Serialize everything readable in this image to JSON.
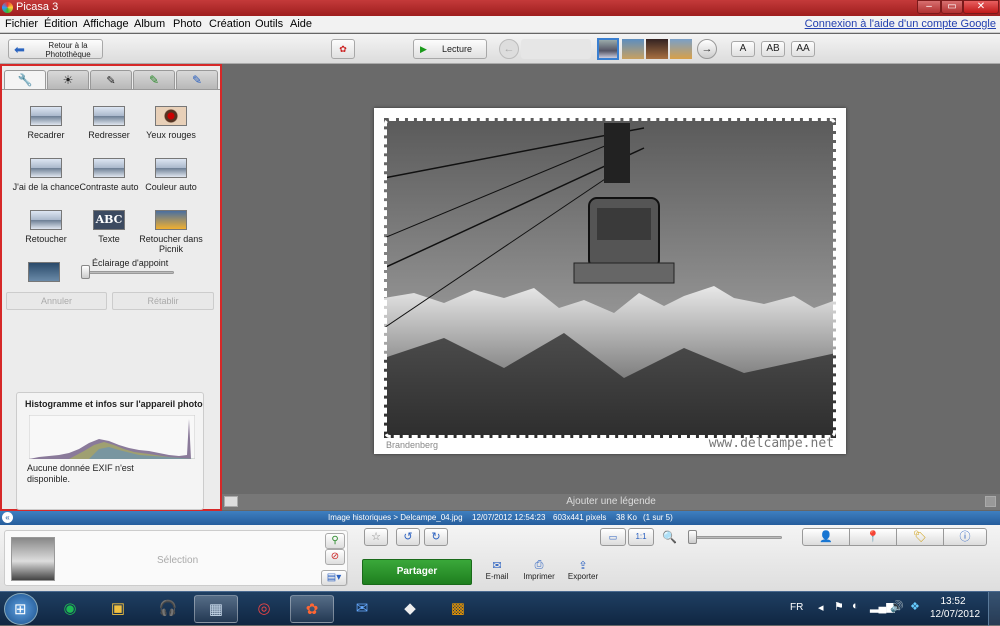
{
  "window": {
    "title": "Picasa 3",
    "controls": {
      "minimize": "–",
      "maximize": "▭",
      "close": "✕"
    }
  },
  "menu": {
    "items": [
      "Fichier",
      "Édition",
      "Affichage",
      "Album",
      "Photo",
      "Création",
      "Outils",
      "Aide"
    ],
    "account_link": "Connexion à l'aide d'un compte Google"
  },
  "toolbar": {
    "back_label": "Retour à la Photothèque",
    "play_label": "Lecture",
    "text_size_buttons": [
      "A",
      "AB",
      "AA"
    ]
  },
  "edit_panel": {
    "tabs": [
      "wrench-icon",
      "sun-icon",
      "brush-icon",
      "brush-green-icon",
      "brush-blue-icon"
    ],
    "tools": [
      {
        "label": "Recadrer"
      },
      {
        "label": "Redresser"
      },
      {
        "label": "Yeux rouges"
      },
      {
        "label": "J'ai de la chance"
      },
      {
        "label": "Contraste auto"
      },
      {
        "label": "Couleur auto"
      },
      {
        "label": "Retoucher"
      },
      {
        "label": "Texte",
        "thumb_text": "ABC"
      },
      {
        "label": "Retoucher dans Picnik"
      }
    ],
    "fill_light_label": "Éclairage d'appoint",
    "undo_label": "Annuler",
    "redo_label": "Rétablir",
    "histogram": {
      "title": "Histogramme et infos sur l'appareil photo",
      "exif_text": "Aucune donnée EXIF n'est disponible."
    }
  },
  "photo": {
    "caption_left": "Brandenberg",
    "watermark": "www.delcampe.net"
  },
  "caption_bar": {
    "placeholder": "Ajouter une légende"
  },
  "status": {
    "path": "Image historiques > Delcampe_04.jpg",
    "datetime": "12/07/2012 12:54:23",
    "dimensions": "603x441 pixels",
    "size": "38 Ko",
    "position": "(1 sur 5)"
  },
  "tray": {
    "selection_label": "Sélection",
    "share_label": "Partager",
    "actions": [
      {
        "label": "E-mail"
      },
      {
        "label": "Imprimer"
      },
      {
        "label": "Exporter"
      }
    ]
  },
  "taskbar": {
    "language": "FR",
    "time": "13:52",
    "date": "12/07/2012"
  }
}
